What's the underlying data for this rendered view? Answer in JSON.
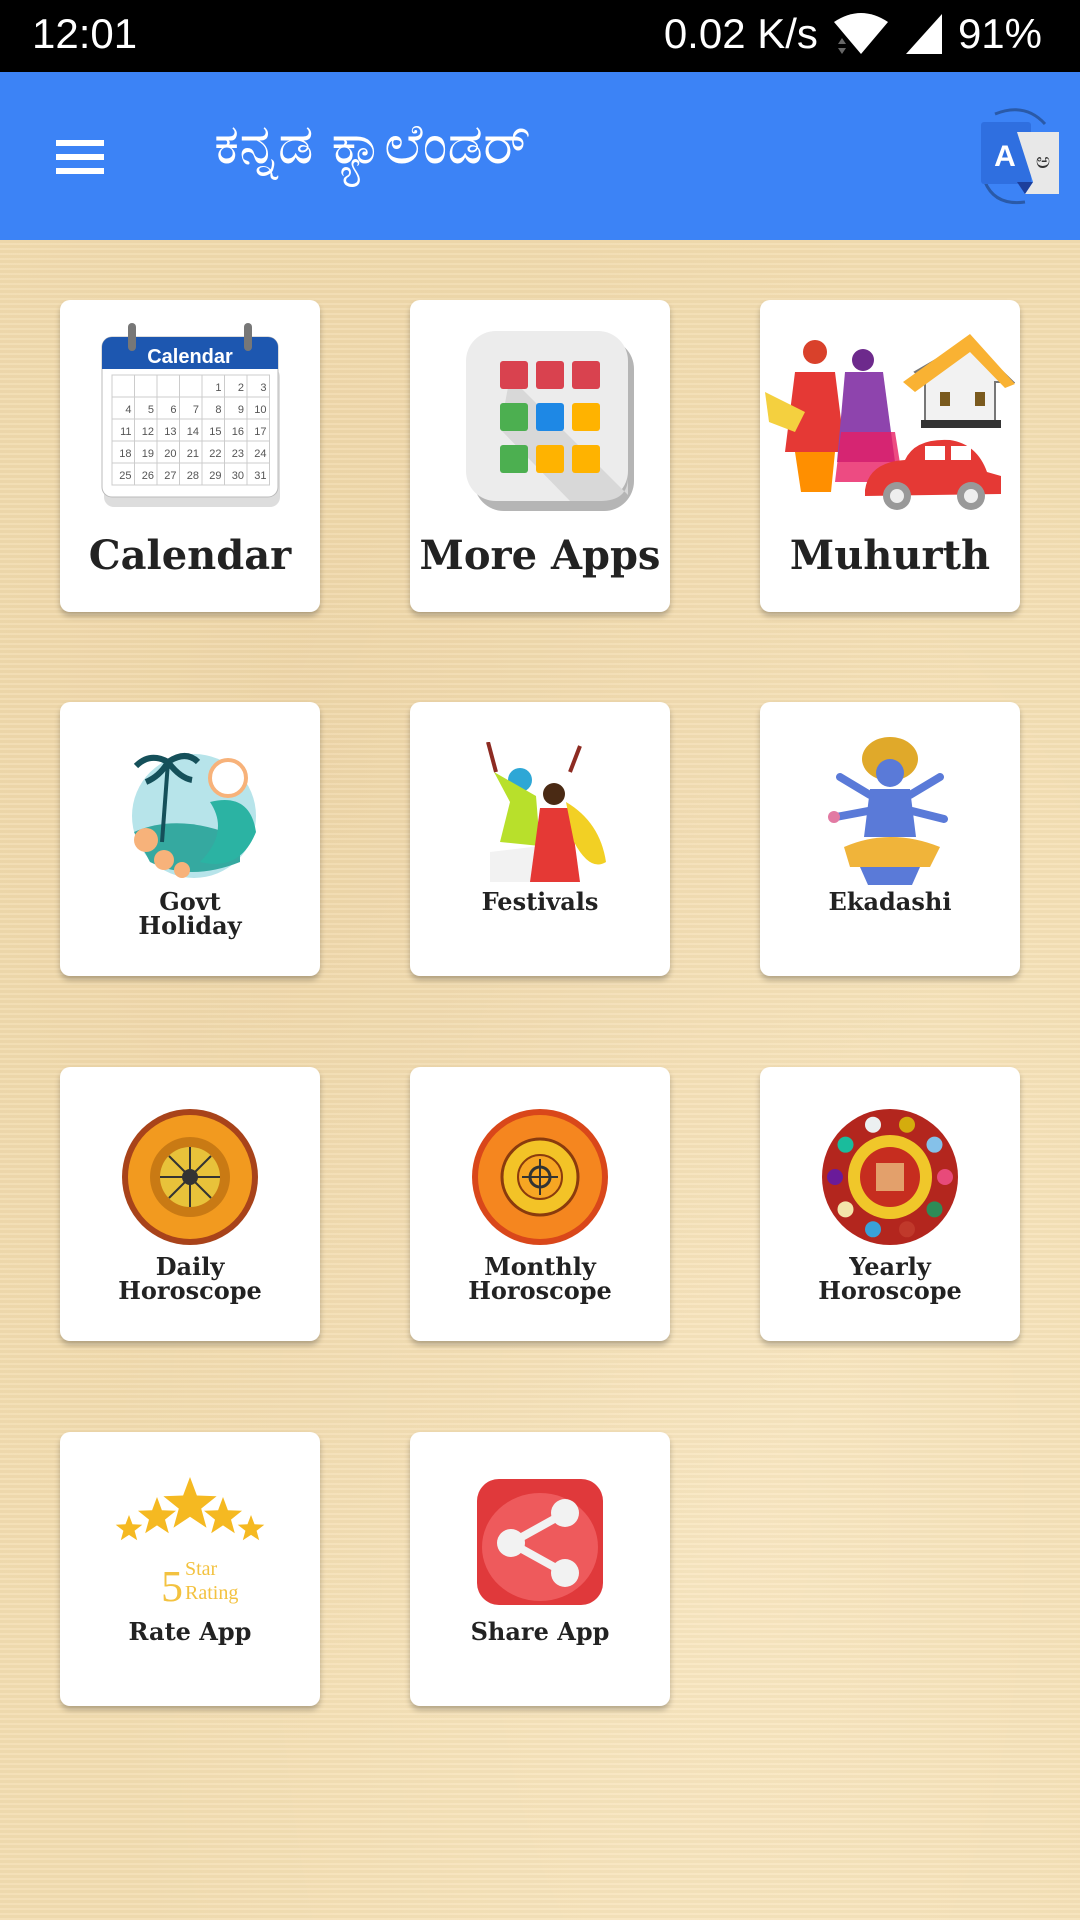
{
  "status_bar": {
    "time": "12:01",
    "network_speed": "0.02 K/s",
    "battery": "91%",
    "icons": [
      "wifi-icon",
      "signal-icon"
    ]
  },
  "app_bar": {
    "title": "ಕನ್ನಡ ಕ್ಯಾಲೆಂಡರ್",
    "menu_icon": "hamburger-menu-icon",
    "action_icon": "translate-icon",
    "color": "#3c83f6"
  },
  "calendar_icon_title": "Calendar",
  "calendar_icon_days": [
    "1",
    "2",
    "3",
    "4",
    "5",
    "6",
    "7",
    "8",
    "9",
    "10",
    "11",
    "12",
    "13",
    "14",
    "15",
    "16",
    "17",
    "18",
    "19",
    "20",
    "21",
    "22",
    "23",
    "24",
    "25",
    "26",
    "27",
    "28",
    "29",
    "30",
    "31"
  ],
  "rating_icon_text": {
    "number": "5",
    "line1": "Star",
    "line2": "Rating"
  },
  "tiles": [
    {
      "label": "Calendar",
      "icon": "calendar-icon"
    },
    {
      "label": "More Apps",
      "icon": "app-grid-icon"
    },
    {
      "label": "Muhurth",
      "icon": "wedding-house-car-icon"
    },
    {
      "label_line1": "Govt",
      "label_line2": "Holiday",
      "icon": "beach-holiday-icon"
    },
    {
      "label": "Festivals",
      "icon": "dancing-couple-icon"
    },
    {
      "label": "Ekadashi",
      "icon": "vishnu-icon"
    },
    {
      "label_line1": "Daily",
      "label_line2": "Horoscope",
      "icon": "zodiac-wheel-icon"
    },
    {
      "label_line1": "Monthly",
      "label_line2": "Horoscope",
      "icon": "zodiac-wheel-icon"
    },
    {
      "label_line1": "Yearly",
      "label_line2": "Horoscope",
      "icon": "gemstone-wheel-icon"
    },
    {
      "label": "Rate App",
      "icon": "five-star-rating-icon"
    },
    {
      "label": "Share App",
      "icon": "share-icon"
    }
  ]
}
